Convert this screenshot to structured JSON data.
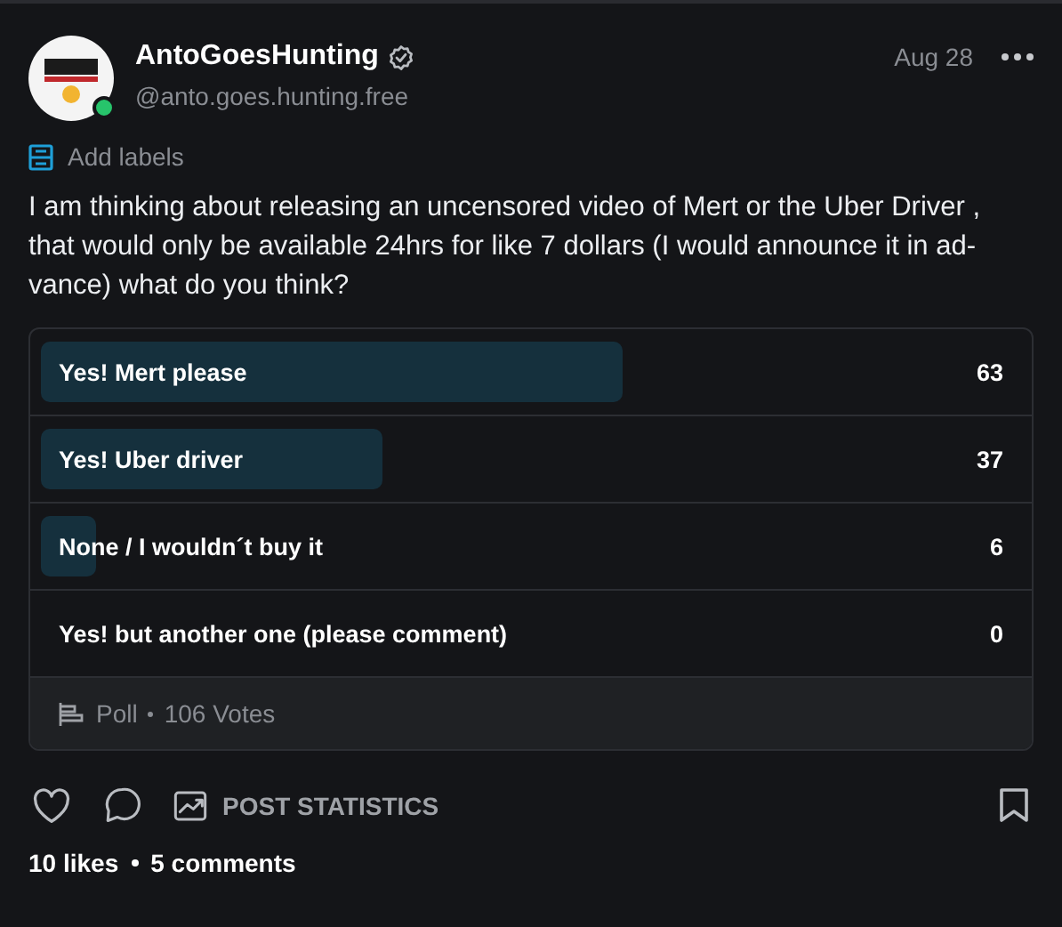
{
  "post": {
    "author": "AntoGoesHunting",
    "verified": true,
    "online": true,
    "handle": "@anto.goes.hunting.free",
    "date": "Aug 28",
    "labels_link": "Add labels",
    "text": "I am thinking about releasing an uncensored video of Mert or the Uber Driver , that would only be available 24hrs for like 7 dollars (I would announce it in ad-vance) what do you think?"
  },
  "poll": {
    "options": [
      {
        "label": "Yes! Mert please",
        "count": "63",
        "level": 0.594
      },
      {
        "label": "Yes! Uber driver",
        "count": "37",
        "level": 0.349
      },
      {
        "label": "None / I wouldn´t buy it",
        "count": "6",
        "level": 0.057
      },
      {
        "label": "Yes! but another one (please comment)",
        "count": "0"
      }
    ],
    "footer_kind": "Poll",
    "votes": "106 Votes"
  },
  "actions": {
    "statistics": "POST STATISTICS"
  },
  "stats": {
    "likes": "10 likes",
    "comments": "5 comments"
  }
}
